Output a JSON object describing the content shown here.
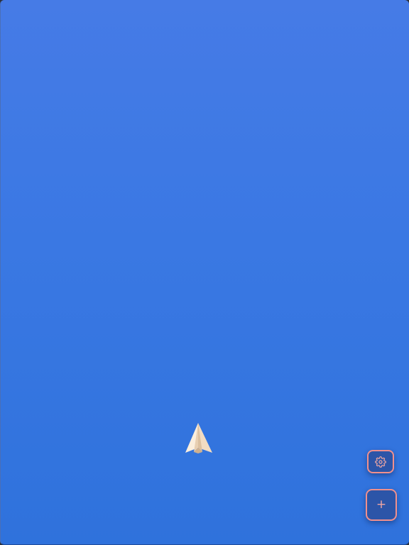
{
  "app": {
    "background_colors": [
      "#467be6",
      "#2f72dc"
    ],
    "accent_color": "#f0908d"
  },
  "plane": {
    "icon": "paper-plane-icon"
  },
  "settings_button": {
    "icon": "gear-icon"
  },
  "add_button": {
    "icon": "plus-icon",
    "label": "+"
  }
}
